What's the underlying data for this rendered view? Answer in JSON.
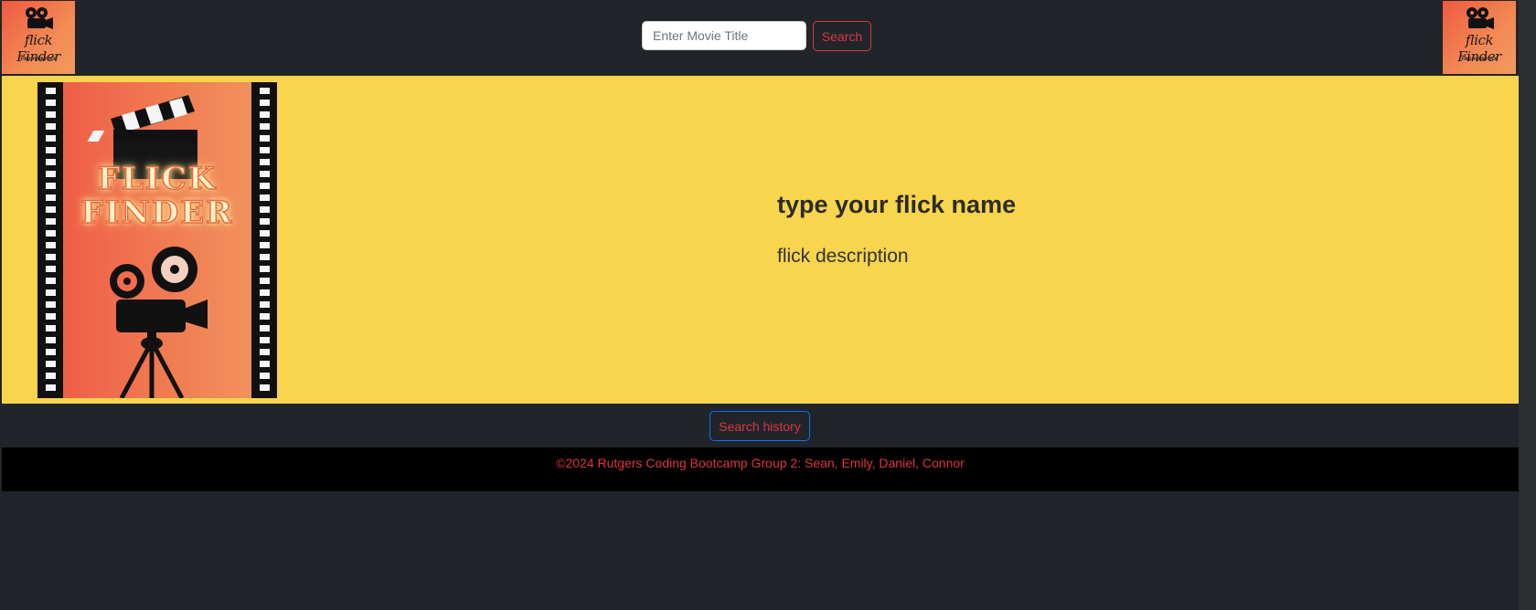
{
  "header": {
    "logo_left": {
      "script": "flick Finder",
      "tagline": "FIND YOUR FLICK"
    },
    "logo_right": {
      "script": "flick Finder",
      "tagline": "FIND YOUR FLICK"
    },
    "search": {
      "placeholder": "Enter Movie Title",
      "value": "",
      "button_label": "Search"
    }
  },
  "hero": {
    "poster": {
      "line1": "FLICK",
      "line2": "FINDER"
    },
    "title": "type your flick name",
    "description": "flick description"
  },
  "history": {
    "button_label": "Search history"
  },
  "footer": {
    "text": "©2024 Rutgers Coding Bootcamp Group 2: Sean, Emily, Daniel, Connor"
  },
  "colors": {
    "page_bg": "#212529",
    "hero_bg": "#f8d54c",
    "accent_red": "#dc3545",
    "accent_blue": "#0d6efd",
    "footer_bg": "#000000"
  },
  "icons": {
    "logo": "movie-camera-icon"
  }
}
